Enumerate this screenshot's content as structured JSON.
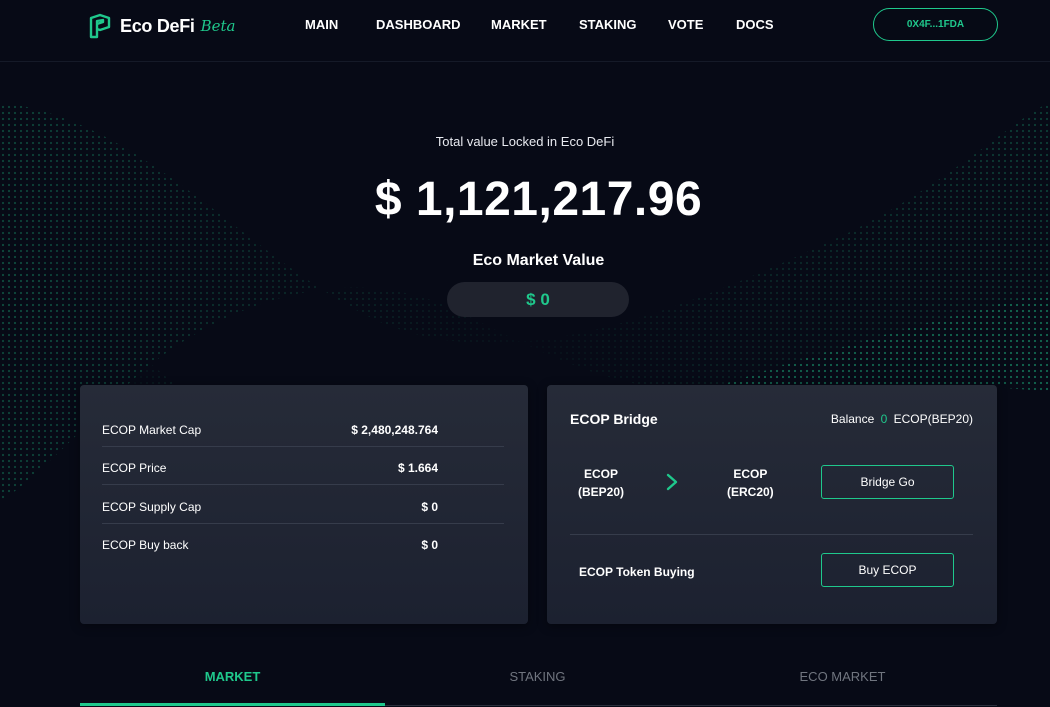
{
  "brand": {
    "name": "Eco DeFi",
    "badge": "Beta",
    "accent_color": "#1fc88c",
    "background_color": "#070a16"
  },
  "nav": {
    "items": [
      "MAIN",
      "DASHBOARD",
      "MARKET",
      "STAKING",
      "VOTE",
      "DOCS"
    ]
  },
  "wallet": {
    "address": "0X4F...1FDA"
  },
  "hero": {
    "tvl_label": "Total value Locked in Eco DeFi",
    "tvl_value": "$ 1,121,217.96",
    "market_value_label": "Eco Market Value",
    "market_value": "$ 0"
  },
  "stats": {
    "rows": [
      {
        "label": "ECOP Market Cap",
        "value": "$ 2,480,248.764"
      },
      {
        "label": "ECOP Price",
        "value": "$ 1.664"
      },
      {
        "label": "ECOP Supply Cap",
        "value": "$ 0"
      },
      {
        "label": "ECOP Buy back",
        "value": "$ 0"
      }
    ]
  },
  "bridge": {
    "title": "ECOP Bridge",
    "balance_label": "Balance",
    "balance_amount": "0",
    "balance_unit": "ECOP(BEP20)",
    "from_token": "ECOP",
    "from_network": "(BEP20)",
    "to_token": "ECOP",
    "to_network": "(ERC20)",
    "arrow_icon": "chevron-right-icon",
    "bridge_button": "Bridge Go",
    "buying_label": "ECOP Token Buying",
    "buy_button": "Buy ECOP"
  },
  "tabs": {
    "items": [
      "MARKET",
      "STAKING",
      "ECO MARKET"
    ],
    "active": "MARKET"
  }
}
